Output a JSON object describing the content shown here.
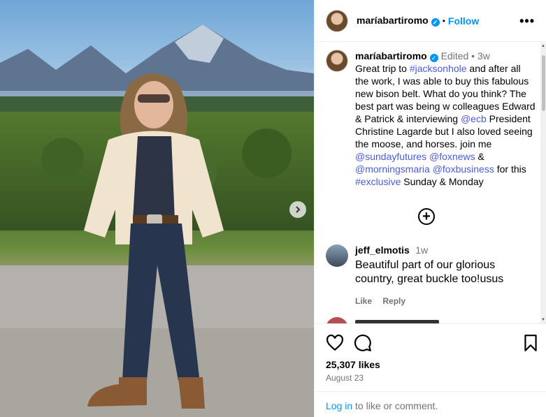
{
  "post": {
    "username": "maríabartiromo",
    "follow_label": "Follow",
    "more_label": "•••",
    "caption": {
      "username": "maríabartiromo",
      "edited": "Edited",
      "time": "3w",
      "text_1": "Great trip to ",
      "tag_1": "#jacksonhole",
      "text_2": " and after all the work, I was able to buy this fabulous new bison belt. What do you think? The best part was being w colleagues Edward & Patrick & interviewing ",
      "tag_2": "@ecb",
      "text_3": " President Christine Lagarde but I also loved seeing the moose, and horses. join me ",
      "tag_3": "@sundayfutures",
      "tag_4": "@foxnews",
      "text_4": " & ",
      "tag_5": "@morningsmaria",
      "tag_6": "@foxbusiness",
      "text_5": " for this ",
      "tag_7": "#exclusive",
      "text_6": " Sunday & Monday"
    },
    "comment": {
      "username": "jeff_elmotis",
      "time": "1w",
      "text": "Beautiful part of our glorious country, great buckle too!usus",
      "like_label": "Like",
      "reply_label": "Reply"
    },
    "likes": "25,307 likes",
    "date": "August 23",
    "login_link": "Log in",
    "login_text": " to like or comment."
  },
  "colors": {
    "accent": "#0095f6",
    "tag": "#4a5cd8",
    "muted": "#737373"
  },
  "icons": [
    "verified-icon",
    "more-icon",
    "add-icon",
    "heart-icon",
    "comment-icon",
    "bookmark-icon",
    "chevron-right-icon"
  ]
}
